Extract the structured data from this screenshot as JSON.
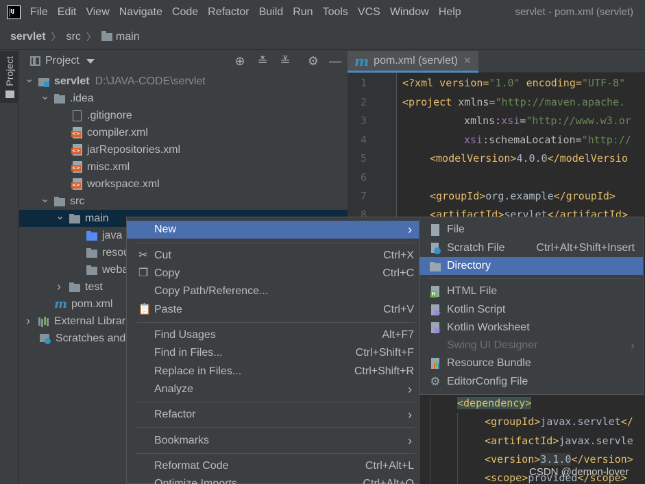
{
  "window": {
    "title": "servlet - pom.xml (servlet)"
  },
  "menu": [
    "File",
    "Edit",
    "View",
    "Navigate",
    "Code",
    "Refactor",
    "Build",
    "Run",
    "Tools",
    "VCS",
    "Window",
    "Help"
  ],
  "breadcrumb": {
    "items": [
      "servlet",
      "src",
      "main"
    ]
  },
  "stripe": {
    "project_label": "Project"
  },
  "project_panel": {
    "title": "Project",
    "tree": [
      {
        "label": "servlet",
        "path": "D:\\JAVA-CODE\\servlet"
      },
      {
        "label": ".idea"
      },
      {
        "label": ".gitignore"
      },
      {
        "label": "compiler.xml"
      },
      {
        "label": "jarRepositories.xml"
      },
      {
        "label": "misc.xml"
      },
      {
        "label": "workspace.xml"
      },
      {
        "label": "src"
      },
      {
        "label": "main"
      },
      {
        "label": "java"
      },
      {
        "label": "resou"
      },
      {
        "label": "weba"
      },
      {
        "label": "test"
      },
      {
        "label": "pom.xml"
      },
      {
        "label": "External Librar"
      },
      {
        "label": "Scratches and"
      }
    ]
  },
  "editor": {
    "tab_label": "pom.xml (servlet)",
    "line_numbers": [
      "1",
      "2",
      "3",
      "4",
      "5",
      "6",
      "7",
      "8"
    ],
    "lines": {
      "l1a": "<?xml version=",
      "l1b": "\"1.0\"",
      "l1c": " encoding=",
      "l1d": "\"UTF-8\"",
      "l2a": "<project",
      "l2b": " xmlns=",
      "l2c": "\"http://maven.apache.",
      "l3a": "xmlns:",
      "l3b": "xsi",
      "l3c": "=",
      "l3d": "\"http://www.w3.or",
      "l4a": "xsi",
      "l4b": ":schemaLocation=",
      "l4c": "\"http://",
      "l5a": "<modelVersion>",
      "l5b": "4.0.0",
      "l5c": "</modelVersio",
      "l7a": "<groupId>",
      "l7b": "org.example",
      "l7c": "</groupId>",
      "l8a": "<artifactId>",
      "l8b": "servlet",
      "l8c": "</artifactId>",
      "d1": "<dependency>",
      "d2a": "<groupId>",
      "d2b": "javax.servlet",
      "d2c": "</",
      "d3a": "<artifactId>",
      "d3b": "javax.servle",
      "d4a": "<version>",
      "d4b": "3.1.0",
      "d4c": "</version>",
      "d5a": "<scope>",
      "d5b": "provided",
      "d5c": "</scope>"
    }
  },
  "context_menu": {
    "items": [
      {
        "label": "New",
        "shortcut": "",
        "submenu": true
      },
      {
        "label": "Cut",
        "shortcut": "Ctrl+X",
        "icon": "scissors-icon"
      },
      {
        "label": "Copy",
        "shortcut": "Ctrl+C",
        "icon": "copy-icon"
      },
      {
        "label": "Copy Path/Reference...",
        "shortcut": ""
      },
      {
        "label": "Paste",
        "shortcut": "Ctrl+V",
        "icon": "paste-icon"
      },
      {
        "label": "Find Usages",
        "shortcut": "Alt+F7"
      },
      {
        "label": "Find in Files...",
        "shortcut": "Ctrl+Shift+F"
      },
      {
        "label": "Replace in Files...",
        "shortcut": "Ctrl+Shift+R"
      },
      {
        "label": "Analyze",
        "shortcut": "",
        "submenu": true
      },
      {
        "label": "Refactor",
        "shortcut": "",
        "submenu": true
      },
      {
        "label": "Bookmarks",
        "shortcut": "",
        "submenu": true
      },
      {
        "label": "Reformat Code",
        "shortcut": "Ctrl+Alt+L"
      },
      {
        "label": "Optimize Imports",
        "shortcut": "Ctrl+Alt+O"
      }
    ]
  },
  "new_submenu": {
    "items": [
      {
        "label": "File",
        "shortcut": ""
      },
      {
        "label": "Scratch File",
        "shortcut": "Ctrl+Alt+Shift+Insert"
      },
      {
        "label": "Directory",
        "shortcut": ""
      },
      {
        "label": "HTML File",
        "shortcut": ""
      },
      {
        "label": "Kotlin Script",
        "shortcut": ""
      },
      {
        "label": "Kotlin Worksheet",
        "shortcut": ""
      },
      {
        "label": "Swing UI Designer",
        "shortcut": "",
        "disabled": true
      },
      {
        "label": "Resource Bundle",
        "shortcut": ""
      },
      {
        "label": "EditorConfig File",
        "shortcut": ""
      }
    ]
  },
  "watermark": "CSDN @demon-lover",
  "colors": {
    "accent": "#4b6eaf",
    "selection": "#0d293e",
    "background": "#3c3f41",
    "editor_bg": "#2b2b2b"
  }
}
